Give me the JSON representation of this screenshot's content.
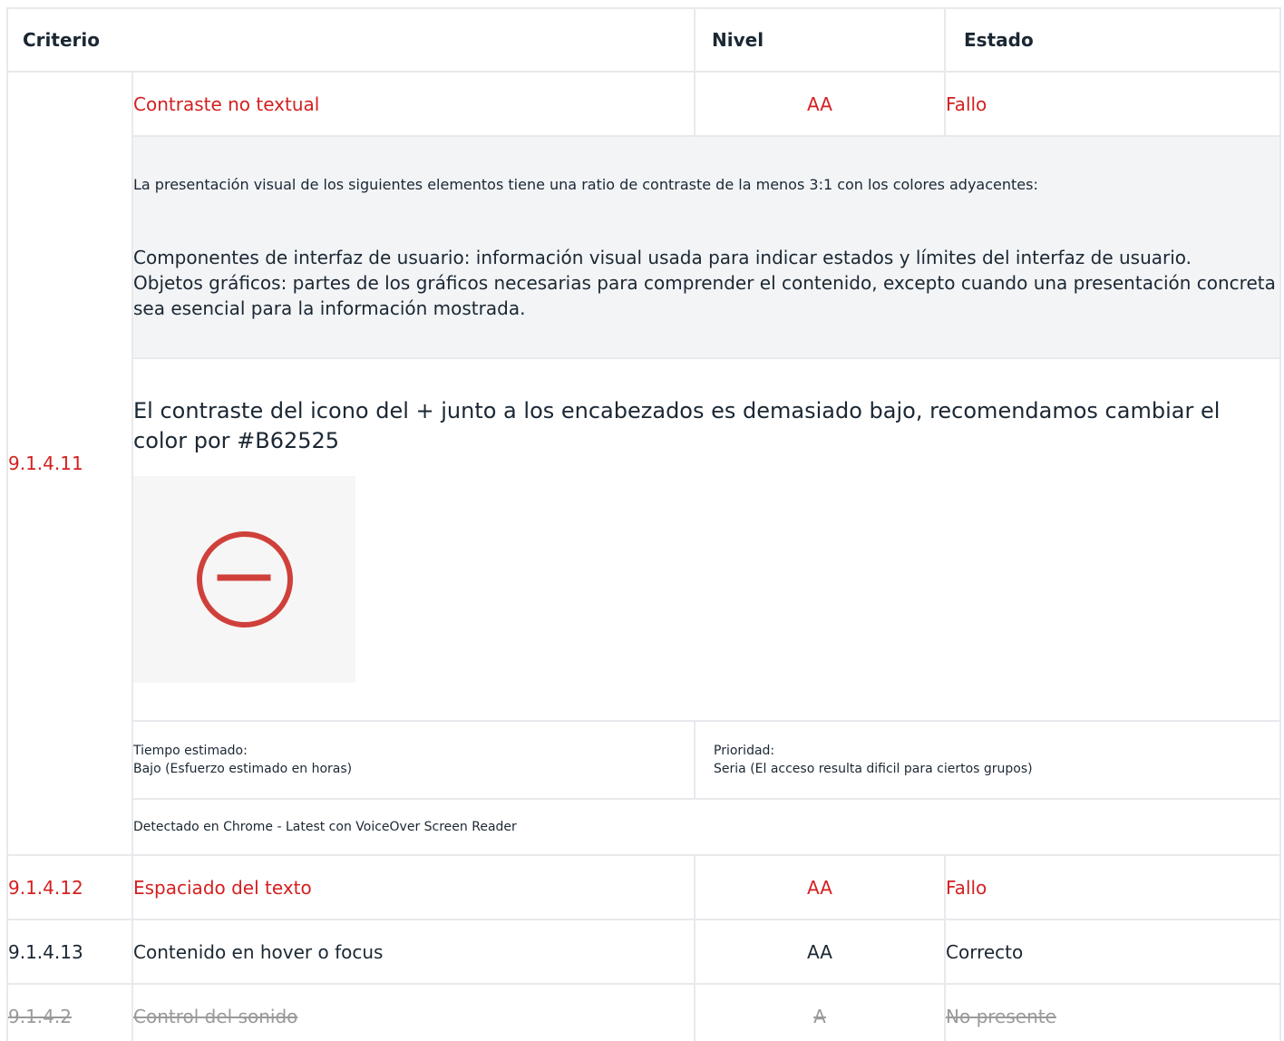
{
  "table": {
    "headers": {
      "criterion": "Criterio",
      "level": "Nivel",
      "state": "Estado"
    },
    "expanded": {
      "id": "9.1.4.11",
      "name": "Contraste no textual",
      "level": "AA",
      "state": "Fallo",
      "description_intro": "La presentación visual de los siguientes elementos tiene una ratio de contraste de la menos 3:1 con los colores adyacentes:",
      "description_items": [
        "Componentes de interfaz de usuario: información visual usada para indicar estados y límites del interfaz de usuario.",
        "Objetos gráficos: partes de los gráficos necesarias para comprender el contenido, excepto cuando una presentación concreta sea esencial para la información mostrada."
      ],
      "finding": "El contraste del icono del + junto a los encabezados es demasiado bajo, recomendamos cambiar el color por #B62525",
      "estimated_time_label": "Tiempo estimado:",
      "estimated_time_value": "Bajo (Esfuerzo estimado en horas)",
      "priority_label": "Prioridad:",
      "priority_value": "Seria (El acceso resulta dificil para ciertos grupos)",
      "detected": "Detectado en Chrome - Latest con VoiceOver Screen Reader",
      "screenshot_icon": "minus-circle-icon"
    },
    "rows": [
      {
        "id": "9.1.4.12",
        "name": "Espaciado del texto",
        "level": "AA",
        "state": "Fallo"
      },
      {
        "id": "9.1.4.13",
        "name": "Contenido en hover o focus",
        "level": "AA",
        "state": "Correcto"
      },
      {
        "id": "9.1.4.2",
        "name": "Control del sonido",
        "level": "A",
        "state": "No presente"
      }
    ]
  },
  "colors": {
    "fail": "#d42020",
    "text": "#1b2733",
    "absent": "#9a9a9a",
    "border": "#e7e9ec",
    "description_bg": "#f2f4f6",
    "icon_red": "#d0403a"
  }
}
